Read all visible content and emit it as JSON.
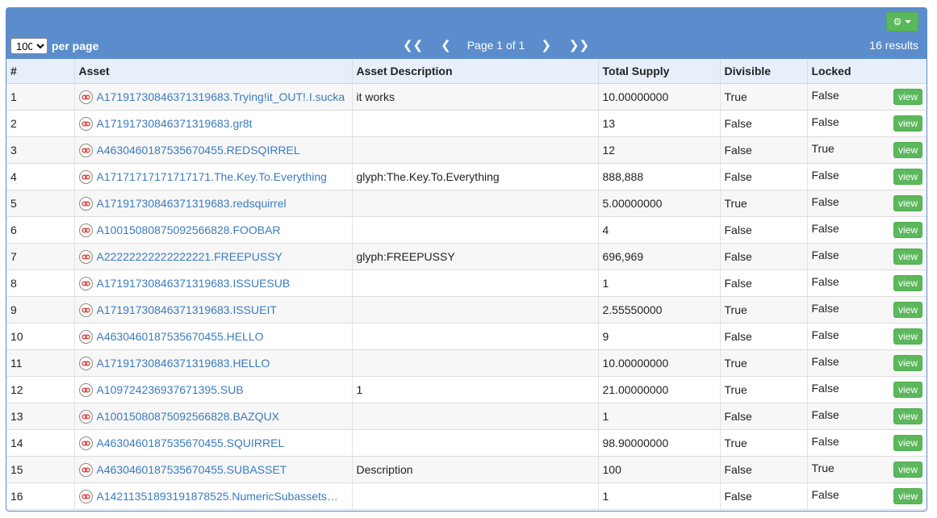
{
  "toolbar": {
    "per_page_value": "100",
    "per_page_label": "per page",
    "page_info": "Page 1 of 1",
    "results_label": "16 results"
  },
  "columns": [
    "#",
    "Asset",
    "Asset Description",
    "Total Supply",
    "Divisible",
    "Locked"
  ],
  "view_label": "view",
  "colors": {
    "header_blue": "#5b8dcc",
    "button_green": "#5cb85c",
    "link_blue": "#3a7bbf",
    "icon_red": "#d9534f"
  },
  "icons": {
    "settings": "gear-icon",
    "asset": "asset-link-icon"
  },
  "rows": [
    {
      "num": "1",
      "asset": "A17191730846371319683.Trying!it_OUT!.I.sucka",
      "description": "it works",
      "supply": "10.00000000",
      "divisible": "True",
      "locked": "False"
    },
    {
      "num": "2",
      "asset": "A17191730846371319683.gr8t",
      "description": "",
      "supply": "13",
      "divisible": "False",
      "locked": "False"
    },
    {
      "num": "3",
      "asset": "A4630460187535670455.REDSQIRREL",
      "description": "",
      "supply": "12",
      "divisible": "False",
      "locked": "True"
    },
    {
      "num": "4",
      "asset": "A17171717171717171.The.Key.To.Everything",
      "description": "glyph:The.Key.To.Everything",
      "supply": "888,888",
      "divisible": "False",
      "locked": "False"
    },
    {
      "num": "5",
      "asset": "A17191730846371319683.redsquirrel",
      "description": "",
      "supply": "5.00000000",
      "divisible": "True",
      "locked": "False"
    },
    {
      "num": "6",
      "asset": "A10015080875092566828.FOOBAR",
      "description": "",
      "supply": "4",
      "divisible": "False",
      "locked": "False"
    },
    {
      "num": "7",
      "asset": "A22222222222222221.FREEPUSSY",
      "description": "glyph:FREEPUSSY",
      "supply": "696,969",
      "divisible": "False",
      "locked": "False"
    },
    {
      "num": "8",
      "asset": "A17191730846371319683.ISSUESUB",
      "description": "",
      "supply": "1",
      "divisible": "False",
      "locked": "False"
    },
    {
      "num": "9",
      "asset": "A17191730846371319683.ISSUEIT",
      "description": "",
      "supply": "2.55550000",
      "divisible": "True",
      "locked": "False"
    },
    {
      "num": "10",
      "asset": "A4630460187535670455.HELLO",
      "description": "",
      "supply": "9",
      "divisible": "False",
      "locked": "False"
    },
    {
      "num": "11",
      "asset": "A17191730846371319683.HELLO",
      "description": "",
      "supply": "10.00000000",
      "divisible": "True",
      "locked": "False"
    },
    {
      "num": "12",
      "asset": "A109724236937671395.SUB",
      "description": "1",
      "supply": "21.00000000",
      "divisible": "True",
      "locked": "False"
    },
    {
      "num": "13",
      "asset": "A10015080875092566828.BAZQUX",
      "description": "",
      "supply": "1",
      "divisible": "False",
      "locked": "False"
    },
    {
      "num": "14",
      "asset": "A4630460187535670455.SQUIRREL",
      "description": "",
      "supply": "98.90000000",
      "divisible": "True",
      "locked": "False"
    },
    {
      "num": "15",
      "asset": "A4630460187535670455.SUBASSET",
      "description": "Description",
      "supply": "100",
      "divisible": "False",
      "locked": "True"
    },
    {
      "num": "16",
      "asset": "A14211351893191878525.NumericSubassets…",
      "description": "",
      "supply": "1",
      "divisible": "False",
      "locked": "False"
    }
  ]
}
